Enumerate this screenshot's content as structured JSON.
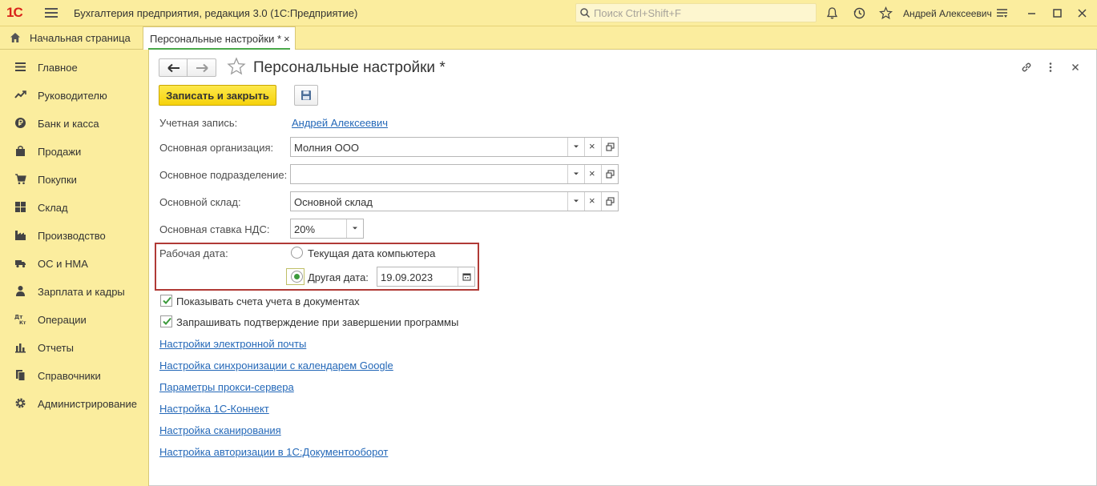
{
  "app": {
    "logo": "1С",
    "title": "Бухгалтерия предприятия, редакция 3.0  (1С:Предприятие)",
    "search_placeholder": "Поиск Ctrl+Shift+F",
    "user": "Андрей Алексеевич"
  },
  "tabs": {
    "home": "Начальная страница",
    "active": "Персональные настройки *",
    "close": "×"
  },
  "sidebar": {
    "items": [
      {
        "label": "Главное",
        "icon": "menu-list-icon"
      },
      {
        "label": "Руководителю",
        "icon": "trend-icon"
      },
      {
        "label": "Банк и касса",
        "icon": "ruble-coin-icon"
      },
      {
        "label": "Продажи",
        "icon": "shopping-bag-icon"
      },
      {
        "label": "Покупки",
        "icon": "cart-icon"
      },
      {
        "label": "Склад",
        "icon": "warehouse-icon"
      },
      {
        "label": "Производство",
        "icon": "factory-icon"
      },
      {
        "label": "ОС и НМА",
        "icon": "truck-icon"
      },
      {
        "label": "Зарплата и кадры",
        "icon": "person-icon"
      },
      {
        "label": "Операции",
        "icon": "dt-kt-icon"
      },
      {
        "label": "Отчеты",
        "icon": "bar-chart-icon"
      },
      {
        "label": "Справочники",
        "icon": "books-icon"
      },
      {
        "label": "Администрирование",
        "icon": "gear-icon"
      }
    ],
    "dtkt_top": "Дт",
    "dtkt_bottom": "Кт"
  },
  "form": {
    "title": "Персональные настройки *",
    "save_close": "Записать и закрыть",
    "account_label": "Учетная запись:",
    "account_value": "Андрей Алексеевич",
    "org_label": "Основная организация:",
    "org_value": "Молния ООО",
    "dept_label": "Основное подразделение:",
    "dept_value": "",
    "warehouse_label": "Основной склад:",
    "warehouse_value": "Основной склад",
    "vat_label": "Основная ставка НДС:",
    "vat_value": "20%",
    "workdate_label": "Рабочая дата:",
    "radio_current": "Текущая дата компьютера",
    "radio_other": "Другая дата:",
    "other_date": "19.09.2023",
    "chk_accounts": "Показывать счета учета в документах",
    "chk_confirm": "Запрашивать подтверждение при завершении программы",
    "clear_symbol": "×"
  },
  "links": [
    "Настройки электронной почты",
    "Настройка синхронизации с календарем Google",
    "Параметры прокси-сервера",
    "Настройка 1С-Коннект",
    "Настройка сканирования",
    "Настройка авторизации в 1С:Документооборот"
  ],
  "colors": {
    "panel_bg": "#fbed9e",
    "accent_yellow": "#f6d20b",
    "link": "#2468b8",
    "highlight_frame": "#b03a36",
    "check_green": "#3c9a3c"
  }
}
